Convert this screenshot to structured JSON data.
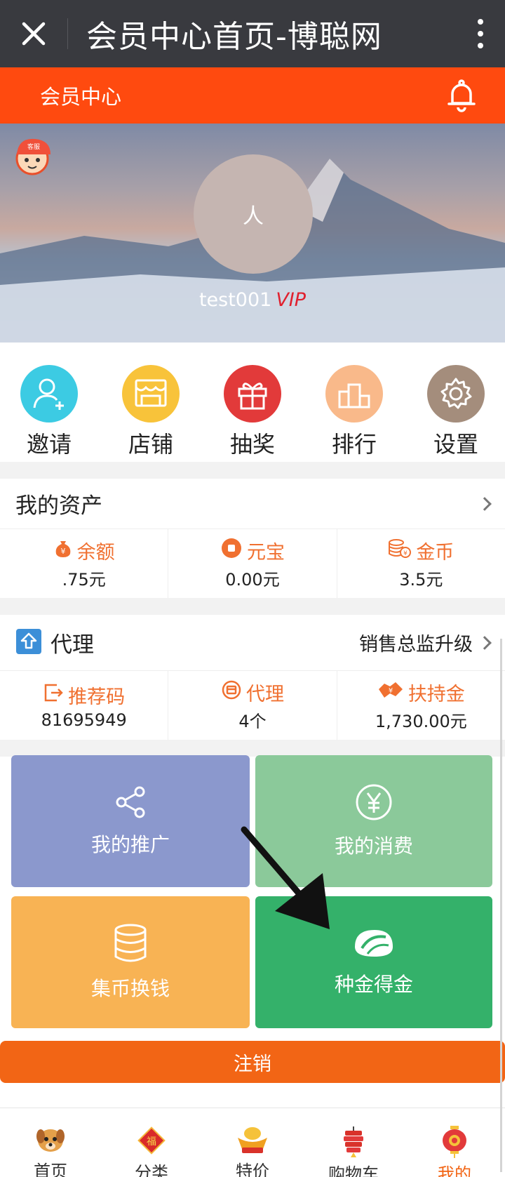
{
  "titlebar": {
    "title": "会员中心首页-博聪网",
    "close_icon": "close-icon",
    "more_icon": "more-vertical-icon"
  },
  "header": {
    "label": "会员中心",
    "bell_icon": "bell-icon"
  },
  "profile": {
    "avatar_text": "人",
    "username": "test001",
    "badge": "VIP"
  },
  "quick_actions": [
    {
      "label": "邀请",
      "icon": "add-user-icon",
      "color": "#3ccbe3"
    },
    {
      "label": "店铺",
      "icon": "shop-icon",
      "color": "#f8c33a"
    },
    {
      "label": "抽奖",
      "icon": "gift-icon",
      "color": "#e23a3a"
    },
    {
      "label": "排行",
      "icon": "podium-icon",
      "color": "#f9b98a"
    },
    {
      "label": "设置",
      "icon": "gear-icon",
      "color": "#a48d7c"
    }
  ],
  "assets": {
    "title": "我的资产",
    "items": [
      {
        "name": "余额",
        "value": ".75元",
        "icon": "money-bag-icon"
      },
      {
        "name": "元宝",
        "value": "0.00元",
        "icon": "ingot-icon"
      },
      {
        "name": "金币",
        "value": "3.5元",
        "icon": "coins-icon"
      }
    ]
  },
  "agent": {
    "title": "代理",
    "upgrade_label": "销售总监升级",
    "items": [
      {
        "name": "推荐码",
        "value": "81695949",
        "icon": "share-out-icon"
      },
      {
        "name": "代理",
        "value": "4个",
        "icon": "agent-icon"
      },
      {
        "name": "扶持金",
        "value": "1,730.00元",
        "icon": "handshake-icon"
      }
    ]
  },
  "tiles": [
    {
      "label": "我的推广",
      "icon": "share-icon",
      "color": "#8b98cd"
    },
    {
      "label": "我的消费",
      "icon": "yen-circle-icon",
      "color": "#8bc99a"
    },
    {
      "label": "集币换钱",
      "icon": "coin-stack-icon",
      "color": "#f8b354"
    },
    {
      "label": "种金得金",
      "icon": "seed-icon",
      "color": "#34b16a"
    }
  ],
  "logout_label": "注销",
  "bottom_nav": [
    {
      "label": "首页",
      "icon": "home-dog-icon",
      "active": false
    },
    {
      "label": "分类",
      "icon": "category-fu-icon",
      "active": false
    },
    {
      "label": "特价",
      "icon": "special-ingot-icon",
      "active": false
    },
    {
      "label": "购物车",
      "icon": "cart-firecracker-icon",
      "active": false
    },
    {
      "label": "我的",
      "icon": "lantern-icon",
      "active": true
    }
  ],
  "colors": {
    "titlebar": "#393a3f",
    "header": "#ff4a0f",
    "accent": "#f26515",
    "stat_text": "#f07030"
  }
}
